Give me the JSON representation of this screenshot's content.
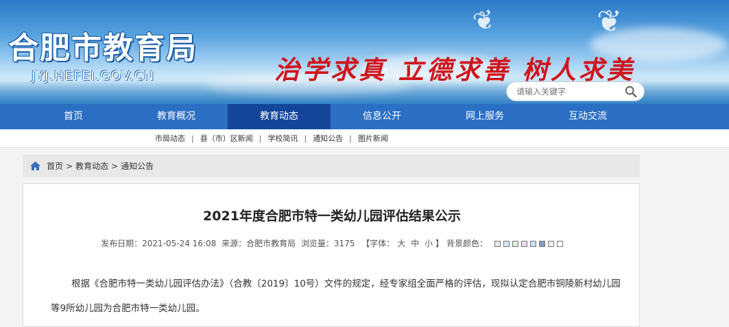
{
  "header": {
    "site_title": "合肥市教育局",
    "domain": "JYJ.HEFEI.GOV.CN",
    "slogan": "治学求真 立德求善 树人求美",
    "search_placeholder": "请输入关键字",
    "search_icon": "magnifier-icon"
  },
  "nav": {
    "items": [
      "首页",
      "教育概况",
      "教育动态",
      "信息公开",
      "网上服务",
      "互动交流"
    ],
    "active": "教育动态",
    "bg_color": "#2a6fc4",
    "active_color": "#13469a"
  },
  "subnav": {
    "items": [
      "市局动态",
      "县（市）区新闻",
      "学校简讯",
      "通知公告",
      "图片新闻"
    ]
  },
  "breadcrumb": {
    "icon": "home-icon",
    "items": [
      "首页",
      "教育动态",
      "通知公告"
    ]
  },
  "article": {
    "title": "2021年度合肥市特一类幼儿园评估结果公示",
    "publish": "发布日期：2021-05-24 16:08",
    "source": "来源：合肥市教育局",
    "views": "浏览量：3175",
    "font_label_open": "【字体：",
    "font_big": "大",
    "font_mid": "中",
    "font_small": "小",
    "font_label_close": "】",
    "bg_label": "背景颜色：",
    "bg_colors": [
      "#e8e8e8",
      "#d6e9f8",
      "#dff0d8",
      "#f9d9ec",
      "#c9e0f4",
      "#7fa0c8",
      "#f0f0f0",
      "#ffffff"
    ],
    "paragraph": "根据《合肥市特一类幼儿园评估办法》（合教〔2019〕10号）文件的规定，经专家组全面严格的评估，现拟认定合肥市铜陵新村幼儿园等9所幼儿园为合肥市特一类幼儿园。"
  }
}
